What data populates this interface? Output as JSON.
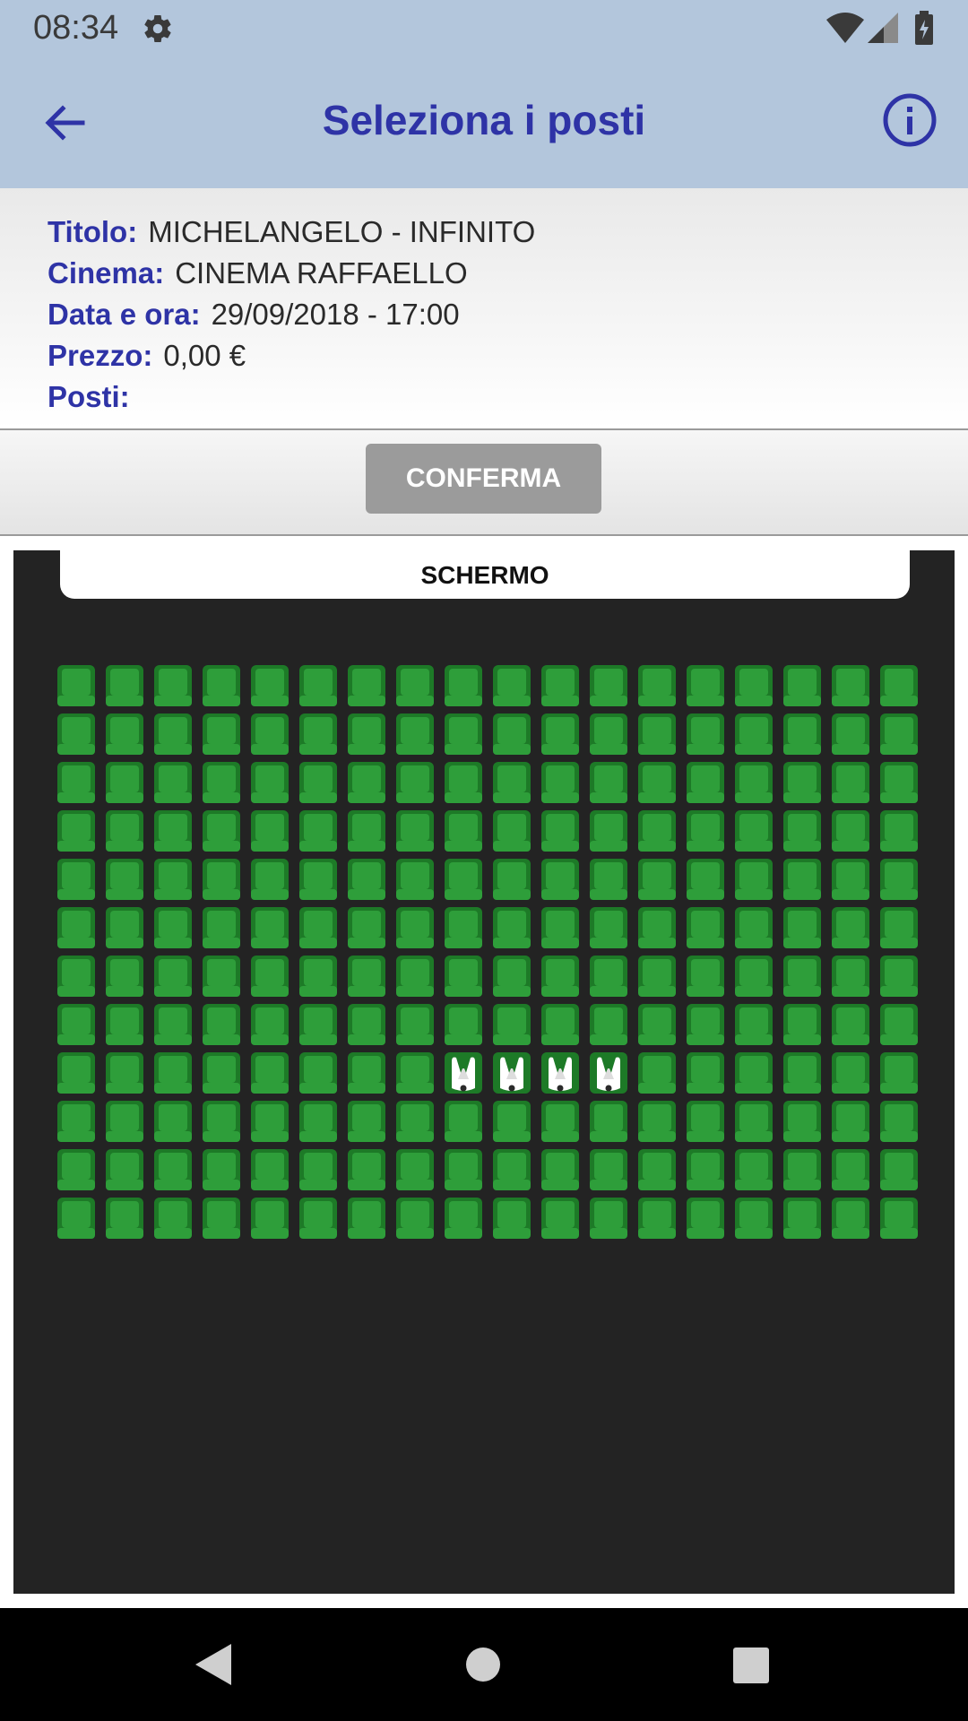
{
  "status_bar": {
    "time": "08:34",
    "icons": [
      "gear-icon",
      "wifi-icon",
      "signal-icon",
      "battery-icon"
    ]
  },
  "app_bar": {
    "title": "Seleziona i posti",
    "back_icon": "arrow-left-icon",
    "info_icon": "info-icon"
  },
  "info": {
    "title_label": "Titolo:",
    "title_value": "MICHELANGELO - INFINITO",
    "cinema_label": "Cinema:",
    "cinema_value": "CINEMA RAFFAELLO",
    "datetime_label": "Data e ora:",
    "datetime_value": "29/09/2018 - 17:00",
    "price_label": "Prezzo:",
    "price_value": "0,00 €",
    "seats_label": "Posti:",
    "seats_value": ""
  },
  "actions": {
    "confirm_label": "CONFERMA"
  },
  "seat_map": {
    "screen_label": "SCHERMO",
    "rows": 12,
    "cols": 18,
    "occupied": [
      [
        8,
        8
      ],
      [
        8,
        9
      ],
      [
        8,
        10
      ],
      [
        8,
        11
      ]
    ],
    "colors": {
      "available": "#2e9e3a",
      "available_dark": "#1d7a27",
      "occupied": "#ffffff",
      "background": "#232323"
    }
  },
  "nav_bar": {
    "icons": [
      "nav-back-icon",
      "nav-home-icon",
      "nav-recent-icon"
    ]
  }
}
